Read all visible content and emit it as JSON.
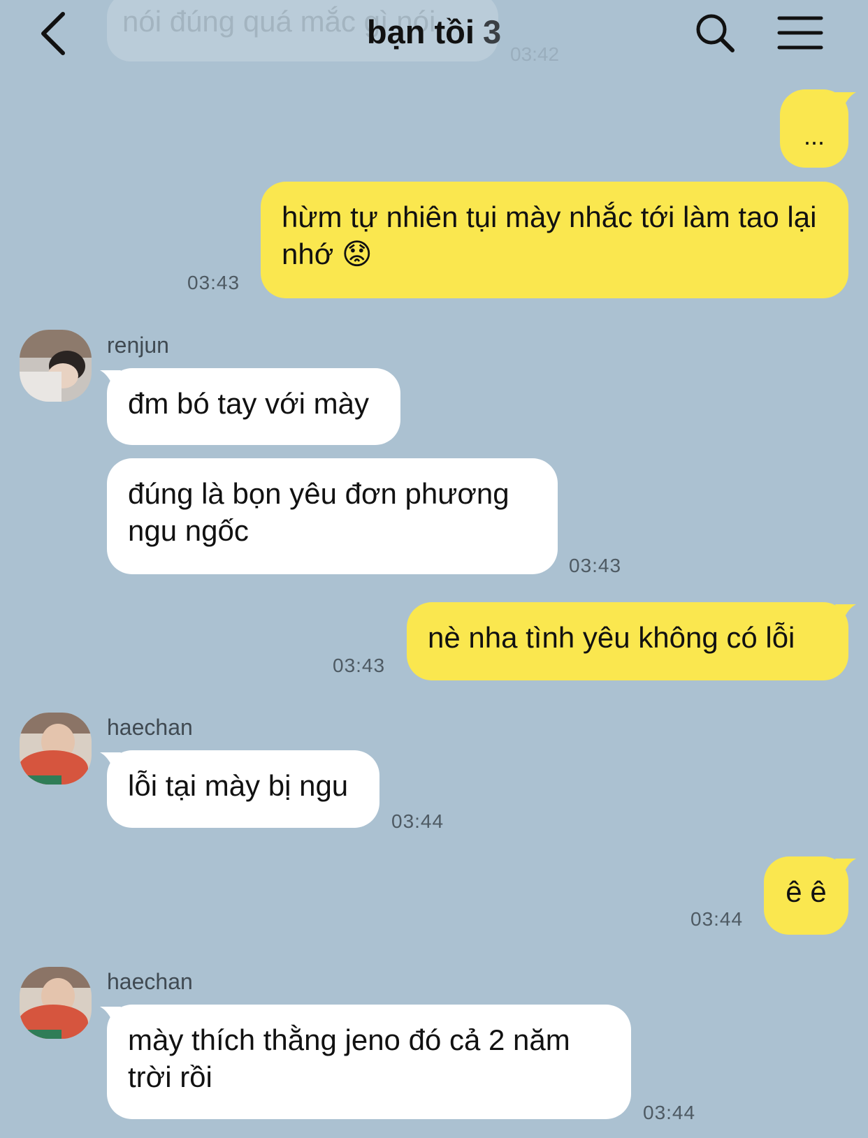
{
  "previous_message": {
    "text": "nói đúng quá mắc gì nói",
    "time": "03:42"
  },
  "header": {
    "title": "bạn tồi",
    "member_count": "3",
    "back_icon": "chevron-left-icon",
    "search_icon": "search-icon",
    "menu_icon": "hamburger-menu-icon"
  },
  "colors": {
    "background": "#abc1d1",
    "my_bubble": "#fae74f",
    "their_bubble": "#ffffff"
  },
  "messages": [
    {
      "sender": "me",
      "text": "...",
      "time": ""
    },
    {
      "sender": "me",
      "text": "hừm tự nhiên tụi mày nhắc tới làm tao lại nhớ 😟",
      "time": "03:43"
    },
    {
      "sender": "renjun",
      "show_name": true,
      "text": "đm bó tay với mày",
      "time": ""
    },
    {
      "sender": "renjun",
      "text": "đúng là bọn yêu đơn phương ngu ngốc",
      "time": "03:43"
    },
    {
      "sender": "me",
      "text": "nè nha tình yêu không có lỗi",
      "time": "03:43"
    },
    {
      "sender": "haechan",
      "show_name": true,
      "text": "lỗi tại mày bị ngu",
      "time": "03:44"
    },
    {
      "sender": "me",
      "text": "ê ê",
      "time": "03:44"
    },
    {
      "sender": "haechan",
      "show_name": true,
      "text": "mày thích thằng jeno đó cả 2 năm trời rồi",
      "time": "03:44"
    }
  ]
}
